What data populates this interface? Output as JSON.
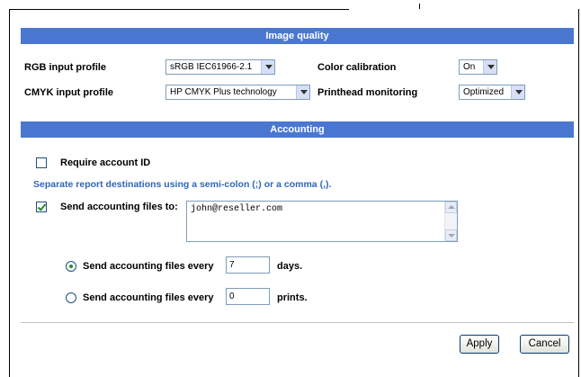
{
  "image_quality": {
    "header": "Image quality",
    "rgb_label": "RGB input profile",
    "rgb_value": "sRGB IEC61966-2.1",
    "cmyk_label": "CMYK input profile",
    "cmyk_value": "HP CMYK Plus technology",
    "calibration_label": "Color calibration",
    "calibration_value": "On",
    "printhead_label": "Printhead monitoring",
    "printhead_value": "Optimized"
  },
  "accounting": {
    "header": "Accounting",
    "require_id_label": "Require account ID",
    "require_id_checked": false,
    "info_text": "Separate report destinations using a semi-colon (;) or a comma (,).",
    "send_files_label": "Send accounting files to:",
    "send_files_checked": true,
    "send_files_value": "john@reseller.com",
    "every_days_label": "Send accounting files every",
    "every_days_value": "7",
    "days_unit": "days.",
    "every_prints_label": "Send accounting files every",
    "every_prints_value": "0",
    "prints_unit": "prints.",
    "selected_option": "days"
  },
  "footer": {
    "apply_label": "Apply",
    "cancel_label": "Cancel"
  }
}
